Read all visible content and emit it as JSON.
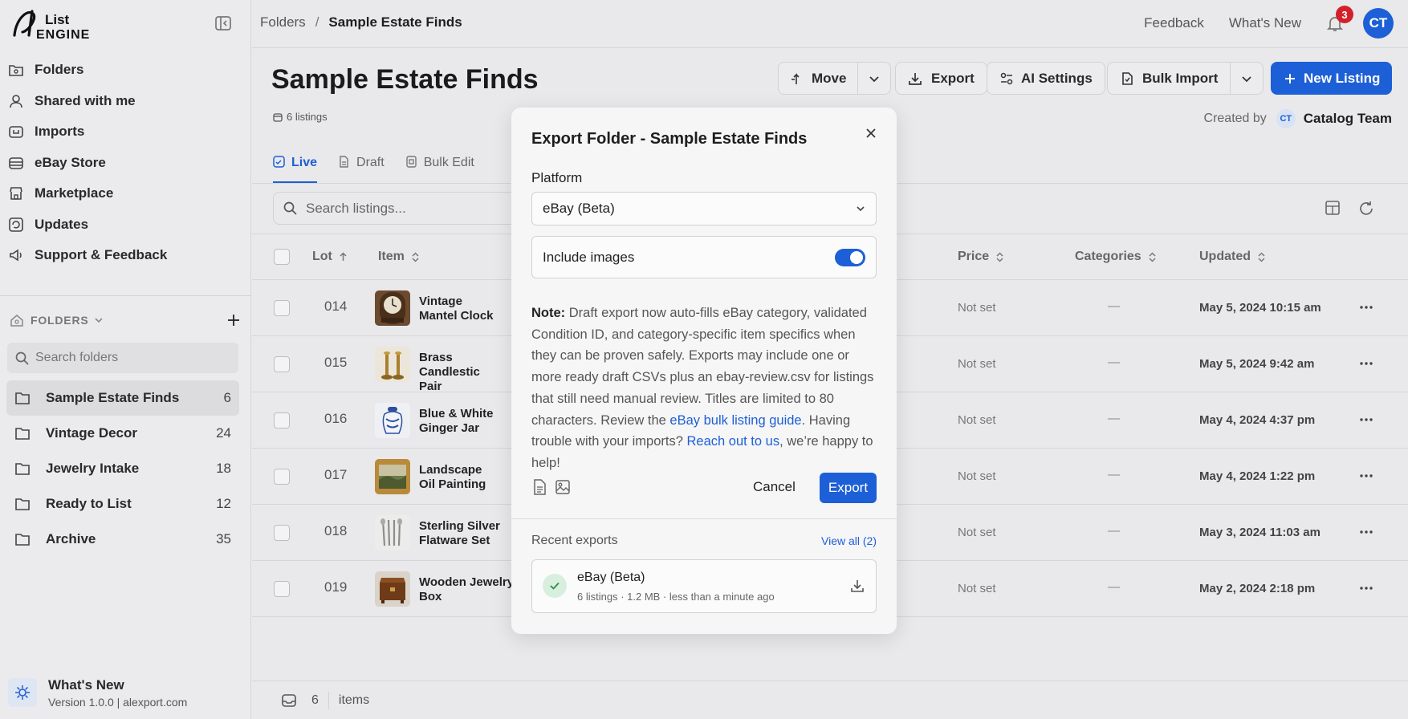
{
  "brand": {
    "name": "List Engine"
  },
  "sidebar": {
    "nav": [
      {
        "label": "Folders",
        "icon": "folder-grid-icon"
      },
      {
        "label": "Shared with me",
        "icon": "user-icon"
      },
      {
        "label": "Imports",
        "icon": "import-icon"
      },
      {
        "label": "eBay Store",
        "icon": "store-icon"
      },
      {
        "label": "Marketplace",
        "icon": "shop-icon"
      },
      {
        "label": "Updates",
        "icon": "updates-icon"
      },
      {
        "label": "Support & Feedback",
        "icon": "megaphone-icon"
      }
    ],
    "folders_heading": "FOLDERS",
    "folder_search_placeholder": "Search folders",
    "folders": [
      {
        "name": "Sample Estate Finds",
        "count": "6"
      },
      {
        "name": "Vintage Decor",
        "count": "24"
      },
      {
        "name": "Jewelry Intake",
        "count": "18"
      },
      {
        "name": "Ready to List",
        "count": "12"
      },
      {
        "name": "Archive",
        "count": "35"
      }
    ],
    "whats_new": {
      "title": "What's New",
      "version": "Version 1.0.0 | alexport.com"
    }
  },
  "topbar": {
    "crumb_root": "Folders",
    "crumb_sep": "/",
    "crumb_current": "Sample Estate Finds",
    "feedback": "Feedback",
    "whats_new": "What's New",
    "notifications": "3",
    "avatar": "CT"
  },
  "header": {
    "title": "Sample Estate Finds",
    "listing_count": "6 listings",
    "move": "Move",
    "export": "Export",
    "ai_settings": "AI Settings",
    "bulk_import": "Bulk Import",
    "new_listing": "New Listing",
    "created_by_label": "Created by",
    "created_by_initials": "CT",
    "created_by_team": "Catalog Team"
  },
  "tabs": [
    {
      "label": "Live"
    },
    {
      "label": "Draft"
    },
    {
      "label": "Bulk Edit"
    }
  ],
  "search": {
    "placeholder": "Search listings..."
  },
  "table": {
    "headers": {
      "lot": "Lot",
      "item": "Item",
      "price": "Price",
      "categories": "Categories",
      "updated": "Updated"
    },
    "rows": [
      {
        "lot": "014",
        "item1": "Vintage",
        "item2": "Mantel Clock",
        "price": "Not set",
        "cat": "—",
        "updated": "May 5, 2024 10:15 am",
        "thumb": "clock"
      },
      {
        "lot": "015",
        "item1": "Brass Candlestic",
        "item2": "Pair",
        "price": "Not set",
        "cat": "—",
        "updated": "May 5, 2024 9:42 am",
        "thumb": "candles"
      },
      {
        "lot": "016",
        "item1": "Blue & White",
        "item2": "Ginger Jar",
        "price": "Not set",
        "cat": "—",
        "updated": "May 4, 2024 4:37 pm",
        "thumb": "jar"
      },
      {
        "lot": "017",
        "item1": "Landscape",
        "item2": "Oil Painting",
        "price": "Not set",
        "cat": "—",
        "updated": "May 4, 2024 1:22 pm",
        "thumb": "painting"
      },
      {
        "lot": "018",
        "item1": "Sterling Silver",
        "item2": "Flatware Set",
        "price": "Not set",
        "cat": "—",
        "updated": "May 3, 2024 11:03 am",
        "thumb": "flatware"
      },
      {
        "lot": "019",
        "item1": "Wooden Jewelry",
        "item2": "Box",
        "price": "Not set",
        "cat": "—",
        "updated": "May 2, 2024 2:18 pm",
        "thumb": "box"
      }
    ]
  },
  "footer": {
    "count": "6",
    "label": "items"
  },
  "modal": {
    "title": "Export Folder - Sample Estate Finds",
    "platform_label": "Platform",
    "platform_value": "eBay (Beta)",
    "include_images": "Include images",
    "include_images_on": true,
    "note_bold": "Note:",
    "note_text": " Draft export now auto-fills eBay category, validated Condition ID, and category-specific item specifics when they can be proven safely. Exports may include one or more ready draft CSVs plus an ebay-review.csv for listings that still need manual review. Titles are limited to 80 characters. Review the ",
    "note_link1": "eBay bulk listing guide",
    "note_mid": ". Having trouble with your imports? ",
    "note_link2": "Reach out to us",
    "note_end": ", we’re happy to help!",
    "cancel": "Cancel",
    "export": "Export",
    "recent_label": "Recent exports",
    "view_all": "View all (2)",
    "recent_title": "eBay (Beta)",
    "recent_meta": "6 listings · 1.2 MB · less than a minute ago"
  },
  "colors": {
    "accent": "#1d5fd6",
    "badge": "#d3202a",
    "success_bg": "#d8efdd"
  }
}
